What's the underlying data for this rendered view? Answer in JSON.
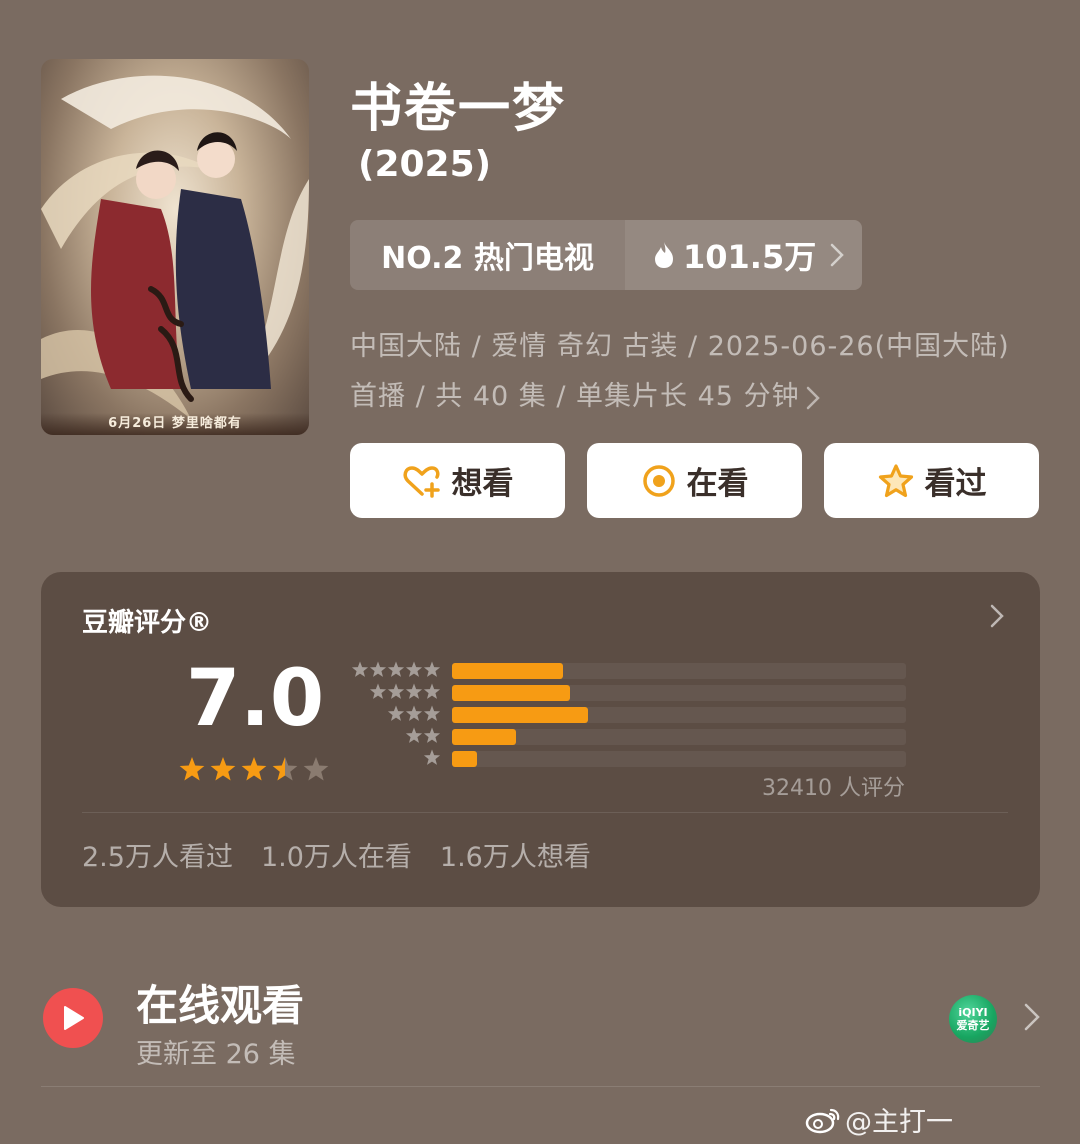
{
  "poster": {
    "alt": "书卷一梦 poster",
    "footer_text": "6月26日 梦里啥都有"
  },
  "show": {
    "title": "书卷一梦",
    "year": "(2025)"
  },
  "rank": {
    "label": "NO.2 热门电视",
    "heat": "101.5万"
  },
  "meta": {
    "line": "中国大陆 / 爱情 奇幻 古装 / 2025-06-26(中国大陆) 首播 / 共 40 集 / 单集片长 45 分钟"
  },
  "actions": {
    "want": "想看",
    "watching": "在看",
    "watched": "看过"
  },
  "rating": {
    "title": "豆瓣评分®",
    "score": "7.0",
    "stars_value": 3.5,
    "stars_max": 5,
    "distribution": [
      {
        "stars": 5,
        "fraction": 0.245
      },
      {
        "stars": 4,
        "fraction": 0.26
      },
      {
        "stars": 3,
        "fraction": 0.3
      },
      {
        "stars": 2,
        "fraction": 0.14
      },
      {
        "stars": 1,
        "fraction": 0.055
      }
    ],
    "count_text": "32410 人评分",
    "stats": [
      "2.5万人看过",
      "1.0万人在看",
      "1.6万人想看"
    ]
  },
  "watch": {
    "title": "在线观看",
    "subtitle": "更新至 26 集",
    "platform_line1": "iQIYI",
    "platform_line2": "爱奇艺"
  },
  "watermark": {
    "text": "@主打一"
  },
  "colors": {
    "background": "#7a6b61",
    "card": "#5c4d44",
    "accent": "#f79b13",
    "play": "#f05050"
  }
}
